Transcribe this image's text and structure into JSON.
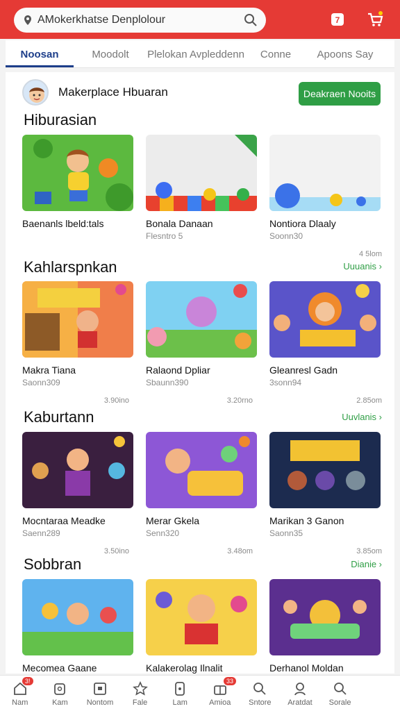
{
  "search": {
    "value": "AMokerkhatse Denplolour"
  },
  "top_icons": [
    "notification-icon",
    "cart-icon"
  ],
  "tabs": [
    {
      "label": "Noosan",
      "active": true
    },
    {
      "label": "Moodolt"
    },
    {
      "label": "Plelokan Avpleddenn"
    },
    {
      "label": "Conne"
    },
    {
      "label": "Apoons Say"
    }
  ],
  "header": {
    "title": "Makerplace Hbuaran",
    "button": "Deakraen Nooits"
  },
  "sections": [
    {
      "title": "Hiburasian",
      "see_all": "",
      "items": [
        {
          "title": "Baenanls lbeld:tals",
          "meta": "",
          "size": "",
          "badge": ""
        },
        {
          "title": "Bonala Danaan",
          "meta": "Flesntro 5",
          "size": "",
          "badge": ""
        },
        {
          "title": "Nontiora Dlaaly",
          "meta": "Soonn30",
          "size": "4 5lom",
          "badge": ""
        }
      ]
    },
    {
      "title": "Kahlarspnkan",
      "see_all": "Uuuanis",
      "items": [
        {
          "title": "Makra Tiana",
          "meta": "Saonn309",
          "size": "3.90ino"
        },
        {
          "title": "Ralaond Dpliar",
          "meta": "Sbaunn390",
          "size": "3.20rno"
        },
        {
          "title": "Gleanresl Gadn",
          "meta": "3sonn94",
          "size": "2.85om"
        }
      ]
    },
    {
      "title": "Kaburtann",
      "see_all": "Uuvlanis",
      "items": [
        {
          "title": "Mocntaraa Meadke",
          "meta": "Saenn289",
          "size": "3.50ino"
        },
        {
          "title": "Merar Gkela",
          "meta": "Senn320",
          "size": "3.48om"
        },
        {
          "title": "Marikan 3 Ganon",
          "meta": "Saonn35",
          "size": "3.85om"
        }
      ]
    },
    {
      "title": "Sobbran",
      "see_all": "Dianie",
      "items": [
        {
          "title": "Mecomea Gaane",
          "meta": "",
          "size": ""
        },
        {
          "title": "Kalakerolag Ilnalit",
          "meta": "",
          "size": ""
        },
        {
          "title": "Derhanol Moldan",
          "meta": "",
          "size": ""
        }
      ]
    }
  ],
  "bottom_nav": [
    {
      "label": "Nam",
      "badge": "3!",
      "icon": "home-icon"
    },
    {
      "label": "Kam",
      "badge": "",
      "icon": "bag-icon"
    },
    {
      "label": "Nontom",
      "badge": "",
      "icon": "tablet-icon"
    },
    {
      "label": "Fale",
      "badge": "",
      "icon": "star-icon"
    },
    {
      "label": "Lam",
      "badge": "",
      "icon": "phone-icon"
    },
    {
      "label": "Amioa",
      "badge": "33",
      "icon": "gift-icon"
    },
    {
      "label": "Sntore",
      "badge": "",
      "icon": "tag-icon"
    },
    {
      "label": "Aratdat",
      "badge": "",
      "icon": "user-icon"
    },
    {
      "label": "Sorale",
      "badge": "",
      "icon": "search-icon"
    }
  ],
  "colors": {
    "brand": "#e53a35",
    "accent": "#2f9e45",
    "tab_active": "#1d3e8a"
  }
}
